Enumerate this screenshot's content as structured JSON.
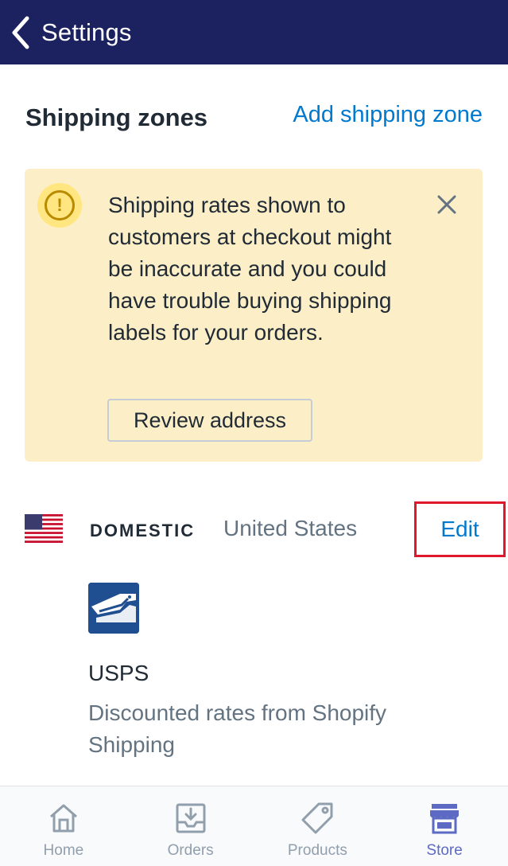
{
  "header": {
    "back_label": "Settings",
    "background": "#1c2260"
  },
  "section": {
    "title": "Shipping zones",
    "add_link": "Add shipping zone"
  },
  "banner": {
    "message": "Shipping rates shown to customers at checkout might be inaccurate and you could have trouble buying shipping labels for your orders.",
    "icon": "exclamation-circle-icon",
    "close_icon": "close-icon",
    "button_label": "Review address",
    "background": "#fcefc7"
  },
  "zone": {
    "flag_icon": "us-flag-icon",
    "name": "DOMESTIC",
    "country": "United States",
    "edit_label": "Edit",
    "highlight_color": "#e0182b"
  },
  "carrier": {
    "logo_icon": "usps-eagle-icon",
    "name": "USPS",
    "description": "Discounted rates from Shopify Shipping"
  },
  "tabbar": {
    "tabs": [
      {
        "label": "Home",
        "icon": "home-icon",
        "active": false
      },
      {
        "label": "Orders",
        "icon": "orders-inbox-icon",
        "active": false
      },
      {
        "label": "Products",
        "icon": "tag-icon",
        "active": false
      },
      {
        "label": "Store",
        "icon": "store-icon",
        "active": true
      }
    ],
    "active_color": "#5c6ac4",
    "inactive_color": "#919eab"
  },
  "colors": {
    "link": "#007ace",
    "text": "#212b36",
    "subdued": "#637381"
  }
}
